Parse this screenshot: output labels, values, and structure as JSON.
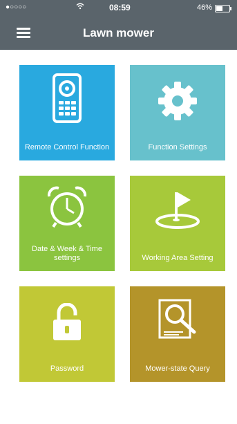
{
  "status_bar": {
    "signal": "●○○○○",
    "wifi": "wifi-icon",
    "time": "08:59",
    "battery": "46%"
  },
  "header": {
    "title": "Lawn mower",
    "menu_icon": "hamburger-menu-icon"
  },
  "tiles": [
    {
      "label": "Remote Control Function",
      "icon": "remote-control-icon",
      "color": "#29a9df"
    },
    {
      "label": "Function Settings",
      "icon": "gear-icon",
      "color": "#67c1cc"
    },
    {
      "label": "Date & Week & Time settings",
      "icon": "alarm-clock-icon",
      "color": "#8bc43f"
    },
    {
      "label": "Working Area Setting",
      "icon": "golf-flag-icon",
      "color": "#a7c93a"
    },
    {
      "label": "Password",
      "icon": "padlock-icon",
      "color": "#c1c836"
    },
    {
      "label": "Mower-state Query",
      "icon": "document-search-icon",
      "color": "#b4942a"
    }
  ]
}
